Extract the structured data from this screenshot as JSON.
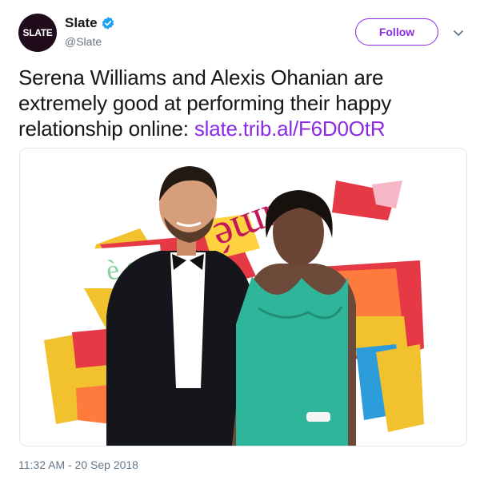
{
  "account": {
    "avatar_text": "SLATE",
    "display_name": "Slate",
    "handle": "@Slate",
    "verified": true
  },
  "follow_label": "Follow",
  "tweet": {
    "text": "Serena Williams and Alexis Ohanian are extremely good at performing their happy relationship online: ",
    "link": "slate.trib.al/F6D0OtR"
  },
  "media": {
    "collage_text_top": "Sumé",
    "collage_text_left": "è que"
  },
  "timestamp": "11:32 AM - 20 Sep 2018",
  "colors": {
    "accent": "#8a2be2",
    "verified": "#1da1f2",
    "avatar_bg": "#1f0b1a",
    "dress": "#2fb59a"
  },
  "icons": [
    "verified-badge-icon",
    "chevron-down-icon"
  ]
}
